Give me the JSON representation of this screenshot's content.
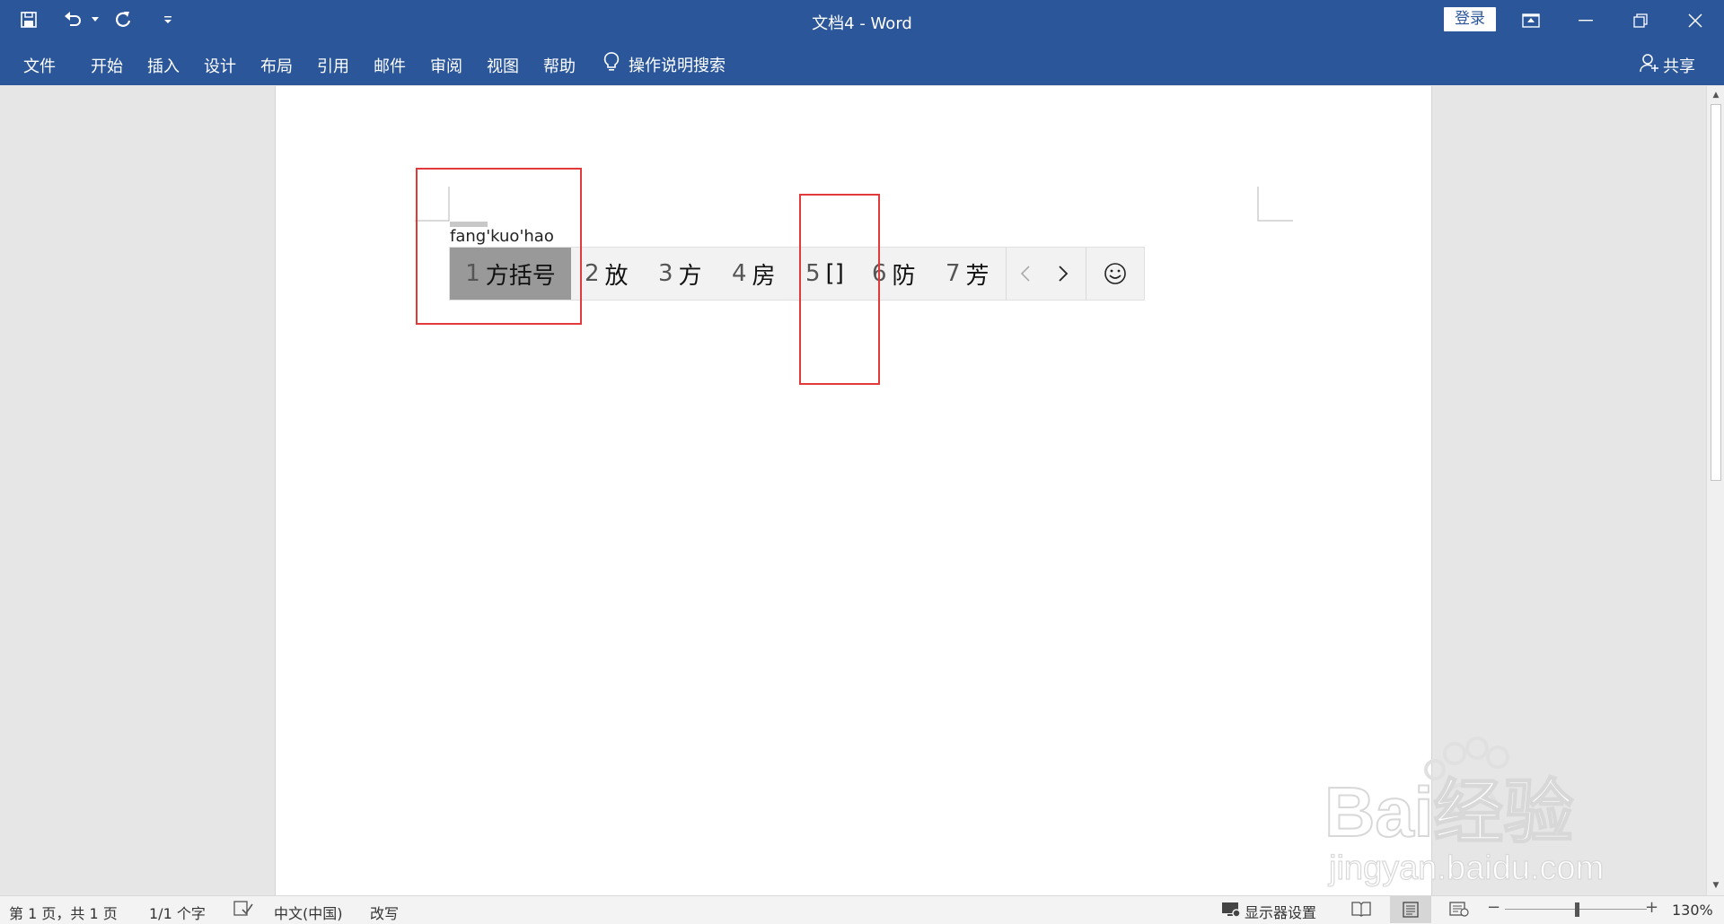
{
  "window": {
    "title": "文档4  -  Word",
    "login_label": "登录"
  },
  "ribbon": {
    "tabs": [
      "文件",
      "开始",
      "插入",
      "设计",
      "布局",
      "引用",
      "邮件",
      "审阅",
      "视图",
      "帮助"
    ],
    "tell_me": "操作说明搜索",
    "share_label": "共享"
  },
  "ime": {
    "pinyin": "fang'kuo'hao",
    "candidates": [
      {
        "num": "1",
        "text": "方括号",
        "selected": true
      },
      {
        "num": "2",
        "text": "放",
        "selected": false
      },
      {
        "num": "3",
        "text": "方",
        "selected": false
      },
      {
        "num": "4",
        "text": "房",
        "selected": false
      },
      {
        "num": "5",
        "text": "[]",
        "selected": false
      },
      {
        "num": "6",
        "text": "防",
        "selected": false
      },
      {
        "num": "7",
        "text": "芳",
        "selected": false
      }
    ],
    "highlight_color": "#e23a3a"
  },
  "status": {
    "page": "第 1 页，共 1 页",
    "words": "1/1 个字",
    "language": "中文(中国)",
    "mode": "改写",
    "display_settings": "显示器设置",
    "zoom": "130%"
  },
  "colors": {
    "titlebar": "#2b579a",
    "page": "#ffffff",
    "workspace": "#e6e6e6"
  },
  "watermark": {
    "brand": "Bai经验",
    "url": "jingyan.baidu.com"
  }
}
